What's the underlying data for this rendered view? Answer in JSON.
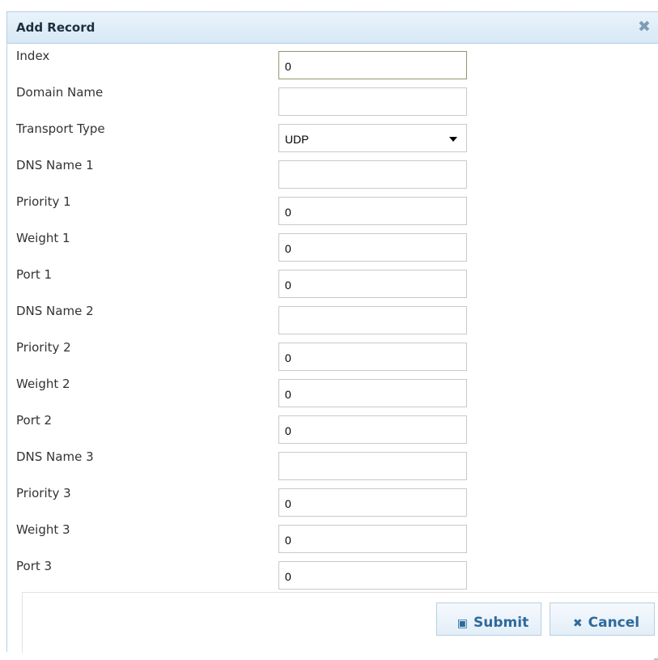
{
  "dialog": {
    "title": "Add Record",
    "close_icon": "close-x-icon"
  },
  "fields": [
    {
      "label": "Index",
      "value": "0",
      "type": "text",
      "focused": true
    },
    {
      "label": "Domain Name",
      "value": "",
      "type": "text"
    },
    {
      "label": "Transport Type",
      "value": "UDP",
      "type": "select"
    },
    {
      "label": "DNS Name 1",
      "value": "",
      "type": "text"
    },
    {
      "label": "Priority 1",
      "value": "0",
      "type": "text"
    },
    {
      "label": "Weight 1",
      "value": "0",
      "type": "text"
    },
    {
      "label": "Port 1",
      "value": "0",
      "type": "text"
    },
    {
      "label": "DNS Name 2",
      "value": "",
      "type": "text"
    },
    {
      "label": "Priority 2",
      "value": "0",
      "type": "text"
    },
    {
      "label": "Weight 2",
      "value": "0",
      "type": "text"
    },
    {
      "label": "Port 2",
      "value": "0",
      "type": "text"
    },
    {
      "label": "DNS Name 3",
      "value": "",
      "type": "text"
    },
    {
      "label": "Priority 3",
      "value": "0",
      "type": "text"
    },
    {
      "label": "Weight 3",
      "value": "0",
      "type": "text"
    },
    {
      "label": "Port 3",
      "value": "0",
      "type": "text"
    }
  ],
  "buttons": {
    "submit_label": "Submit",
    "submit_icon": "save-icon",
    "cancel_label": "Cancel",
    "cancel_icon": "x-icon"
  },
  "colors": {
    "accent": "#2e6a9c",
    "titlebar": "#d7e8f6",
    "border": "#b7cfe2"
  }
}
